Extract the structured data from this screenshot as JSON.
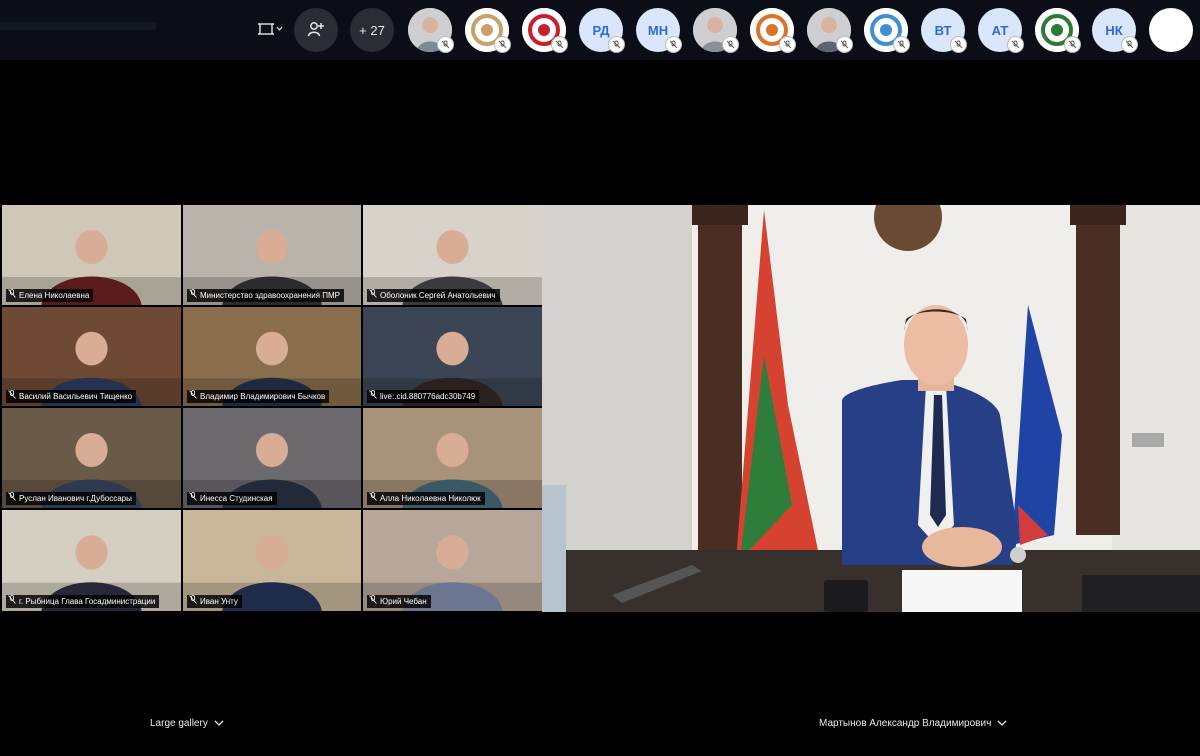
{
  "toolbar": {
    "layout_icon_name": "screen-layout-icon",
    "add_participant_icon_name": "add-person-icon",
    "overflow_count": "+ 27",
    "avatars": [
      {
        "kind": "photo",
        "name": "participant-avatar-1",
        "color": "#7d8a96"
      },
      {
        "kind": "logo",
        "name": "participant-avatar-2",
        "color": "#c7a06a"
      },
      {
        "kind": "logo",
        "name": "participant-avatar-3",
        "color": "#c8202a"
      },
      {
        "kind": "initials",
        "label": "РД"
      },
      {
        "kind": "initials",
        "label": "МН"
      },
      {
        "kind": "photo",
        "name": "participant-avatar-6",
        "color": "#8b8f96"
      },
      {
        "kind": "logo",
        "name": "participant-avatar-7",
        "color": "#d9742a"
      },
      {
        "kind": "photo",
        "name": "participant-avatar-8",
        "color": "#5b6472"
      },
      {
        "kind": "logo",
        "name": "participant-avatar-9",
        "color": "#3e8ed6"
      },
      {
        "kind": "initials",
        "label": "ВТ"
      },
      {
        "kind": "initials",
        "label": "АТ"
      },
      {
        "kind": "logo",
        "name": "participant-avatar-12",
        "color": "#2c7a34"
      },
      {
        "kind": "initials",
        "label": "НК"
      },
      {
        "kind": "blank",
        "name": "participant-avatar-14",
        "color": "#ffffff"
      }
    ]
  },
  "gallery": [
    {
      "label": "Елена Николаевна",
      "bg": "#cfc7b7",
      "person": "#5a1c1c"
    },
    {
      "label": "Министерство здравоохранения ПМР",
      "bg": "#b9b3ab",
      "person": "#2b2b30"
    },
    {
      "label": "Оболоник Сергей Анатольевич",
      "bg": "#d8d3ca",
      "person": "#3a3a40"
    },
    {
      "label": "Василий Васильевич Тищенко",
      "bg": "#6e4a34",
      "person": "#243150"
    },
    {
      "label": "Владимир Владимирович Бычков",
      "bg": "#8a6d4c",
      "person": "#1f2a3c"
    },
    {
      "label": "live:.cid.880776adc30b749",
      "bg": "#3c4556",
      "person": "#2a2020"
    },
    {
      "label": "Руслан Иванович г.Дубоссары",
      "bg": "#6a5a48",
      "person": "#2d3a52"
    },
    {
      "label": "Инесса Студинская",
      "bg": "#6c6a6e",
      "person": "#222a3a"
    },
    {
      "label": "Алла Николаевна Николюк",
      "bg": "#a8927a",
      "person": "#3b5866"
    },
    {
      "label": "г. Рыбница Глава Госадминистрации",
      "bg": "#d5cec3",
      "person": "#26283a"
    },
    {
      "label": "Иван Унту",
      "bg": "#c9b79a",
      "person": "#1e2c4a"
    },
    {
      "label": "Юрий Чебан",
      "bg": "#b6a79a",
      "person": "#6c7690"
    }
  ],
  "bottom": {
    "view_label": "Large gallery",
    "speaker_label": "Мартынов Александр Владимирович"
  }
}
